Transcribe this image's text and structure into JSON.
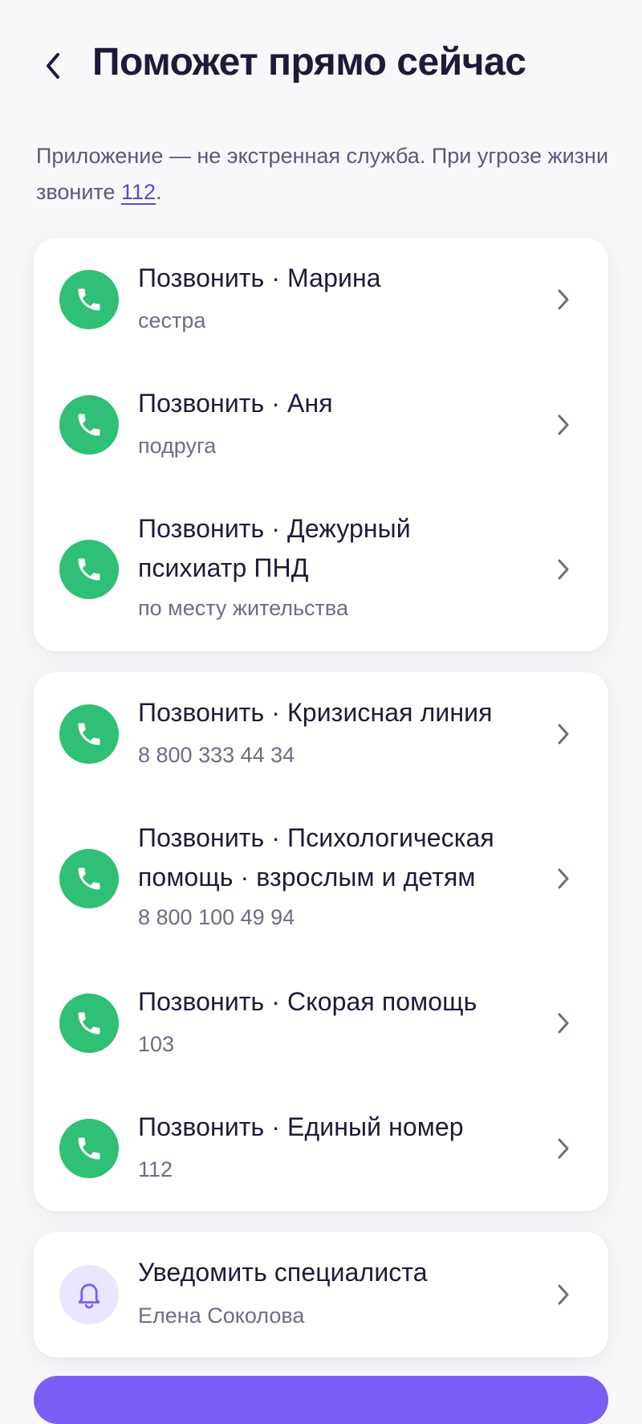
{
  "header": {
    "title": "Поможет прямо сейчас"
  },
  "disclaimer": {
    "text_before": "Приложение — не экстренная служба. При угрозе жизни звоните ",
    "link": "112",
    "text_after": "."
  },
  "personal_contacts": [
    {
      "title": "Позвонить · Марина",
      "subtitle": "сестра"
    },
    {
      "title": "Позвонить · Аня",
      "subtitle": "подруга"
    },
    {
      "title": "Позвонить · Дежурный психиатр ПНД",
      "subtitle": "по месту жительства"
    }
  ],
  "hotlines": [
    {
      "title": "Позвонить · Кризисная линия",
      "subtitle": "8 800 333 44 34"
    },
    {
      "title": "Позвонить · Психологическая помощь · взрослым и детям",
      "subtitle": "8 800 100 49 94"
    },
    {
      "title": "Позвонить · Скорая помощь",
      "subtitle": "103"
    },
    {
      "title": "Позвонить · Единый номер",
      "subtitle": "112"
    }
  ],
  "notify": {
    "title": "Уведомить специалиста",
    "subtitle": "Елена Соколова"
  },
  "icons": {
    "back": "chevron-left-icon",
    "call": "phone-icon",
    "notify": "bell-icon",
    "row_arrow": "chevron-right-icon"
  },
  "colors": {
    "accent": "#7b5cf5",
    "call_green": "#2fbf75",
    "link": "#5a48d6",
    "bell_bg": "#ebe6ff",
    "text_primary": "#1d1b3a",
    "text_secondary": "#6e6c86"
  }
}
